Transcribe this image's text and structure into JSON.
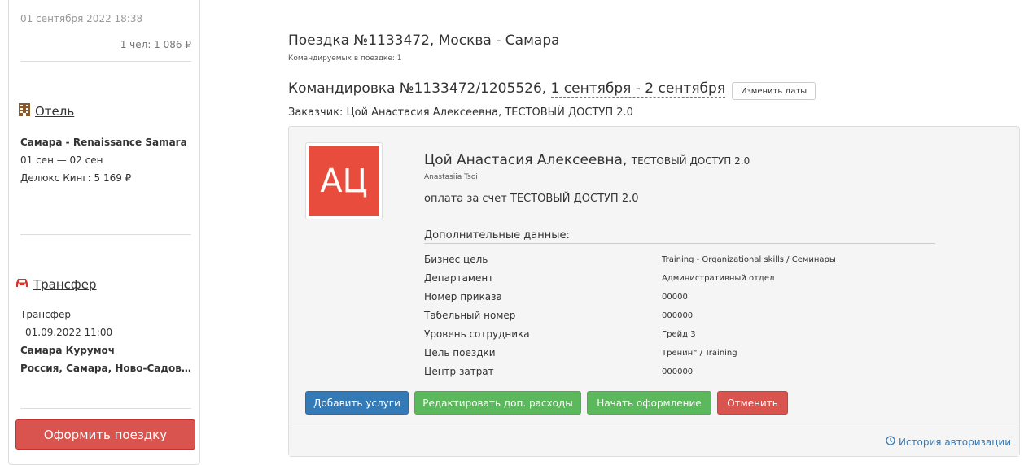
{
  "sidebar": {
    "date": "01 сентября 2022 18:38",
    "price": "1 чел: 1 086 ₽",
    "hotel": {
      "icon": "building-icon",
      "title": "Отель",
      "name": "Самара - Renaissance Samara",
      "dates": "01 сен — 02 сен",
      "room": "Делюкс Кинг: 5 169 ₽"
    },
    "transfer": {
      "icon": "car-icon",
      "title": "Трансфер",
      "type": "Трансфер",
      "datetime": "01.09.2022 11:00",
      "from": "Самара Курумоч",
      "to": "Россия, Самара, Ново-Садовая улица"
    },
    "book_button": "Оформить поездку"
  },
  "main": {
    "trip_title": "Поездка №1133472, Москва - Самара",
    "trip_sub": "Командируемых в поездке: 1",
    "mission_prefix": "Командировка №1133472/1205526, ",
    "mission_dates": "1 сентября - 2 сентября",
    "change_dates_button": "Изменить даты",
    "customer": "Заказчик: Цой Анастасия Алексеевна, ТЕСТОВЫЙ ДОСТУП 2.0"
  },
  "traveler": {
    "initials": "АЦ",
    "name": "Цой Анастасия Алексеевна,",
    "org": "ТЕСТОВЫЙ ДОСТУП 2.0",
    "latin_name": "Anastasiia Tsoi",
    "payment": "оплата за счет ТЕСТОВЫЙ ДОСТУП 2.0",
    "extra_title": "Дополнительные данные:",
    "fields": [
      {
        "label": "Бизнес цель",
        "value": "Training - Organizational skills / Семинары"
      },
      {
        "label": "Департамент",
        "value": "Административный отдел"
      },
      {
        "label": "Номер приказа",
        "value": "00000"
      },
      {
        "label": "Табельный номер",
        "value": "000000"
      },
      {
        "label": "Уровень сотрудника",
        "value": "Грейд 3"
      },
      {
        "label": "Цель поездки",
        "value": "Тренинг / Training"
      },
      {
        "label": "Центр затрат",
        "value": "000000"
      }
    ]
  },
  "actions": {
    "add_services": "Добавить услуги",
    "edit_expenses": "Редактировать доп. расходы",
    "start_booking": "Начать оформление",
    "cancel": "Отменить"
  },
  "footer": {
    "auth_history": "История авторизации",
    "icon": "clock-icon"
  },
  "colors": {
    "primary": "#337ab7",
    "success": "#5cb85c",
    "danger": "#d9534f",
    "avatar": "#e74c3c",
    "hotel_icon": "#8b5a2b",
    "car_icon": "#d9342b"
  }
}
